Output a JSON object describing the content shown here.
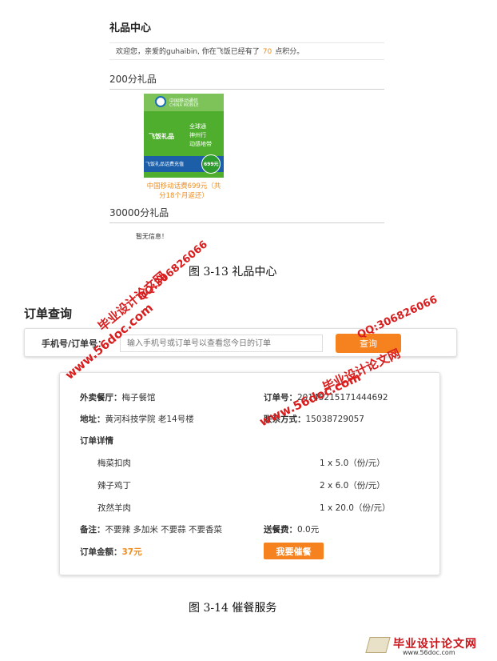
{
  "gift_center": {
    "title": "礼品中心",
    "welcome_prefix": "欢迎您，亲爱的guhaibin, 你在飞饭已经有了",
    "points": "70",
    "welcome_suffix": "点积分。",
    "section_200": "200分礼品",
    "card": {
      "logo_cn": "中国移动通信",
      "logo_en": "CHINA MOBILE",
      "feifan": "飞饭礼品",
      "slogan": [
        "全球通",
        "神州行",
        "动感地带"
      ],
      "strip_text": "飞饭礼品话费充值",
      "price": "699元"
    },
    "card_caption_line1": "中国移动话费699元（共",
    "card_caption_line2": "分18个月返还）",
    "section_30000": "30000分礼品",
    "no_info": "暂无信息！",
    "figure_caption": "图 3-13 礼品中心"
  },
  "order_query": {
    "title": "订单查询",
    "search_label": "手机号/订单号：",
    "search_placeholder": "输入手机号或订单号以查看您今日的订单",
    "search_button": "查询",
    "restaurant_label": "外卖餐厅：",
    "restaurant": "梅子餐馆",
    "order_no_label": "订单号：",
    "order_no": "20145215171444692",
    "address_label": "地址：",
    "address": "黄河科技学院 老14号楼",
    "contact_label": "联系方式：",
    "contact": "15038729057",
    "details_label": "订单详情",
    "items": [
      {
        "name": "梅菜扣肉",
        "qty": "1 x 5.0（份/元）"
      },
      {
        "name": "辣子鸡丁",
        "qty": "2 x 6.0（份/元）"
      },
      {
        "name": "孜然羊肉",
        "qty": "1 x 20.0（份/元）"
      }
    ],
    "note_label": "备注：",
    "note": "不要辣 多加米 不要蒜 不要香菜",
    "delivery_label": "送餐费：",
    "delivery_fee": "0.0元",
    "total_label": "订单金额：",
    "total": "37元",
    "urge_button": "我要催餐",
    "figure_caption": "图 3-14 催餐服务"
  },
  "watermarks": {
    "site_name": "毕业设计论文网",
    "url": "www.56doc.com",
    "qq": "QQ:306826066"
  },
  "footer": {
    "name": "毕业设计论文网",
    "url": "www.56doc.com"
  },
  "colors": {
    "accent_orange": "#f5821f",
    "points_orange": "#f08c1e",
    "watermark_red": "#d81e1e"
  }
}
